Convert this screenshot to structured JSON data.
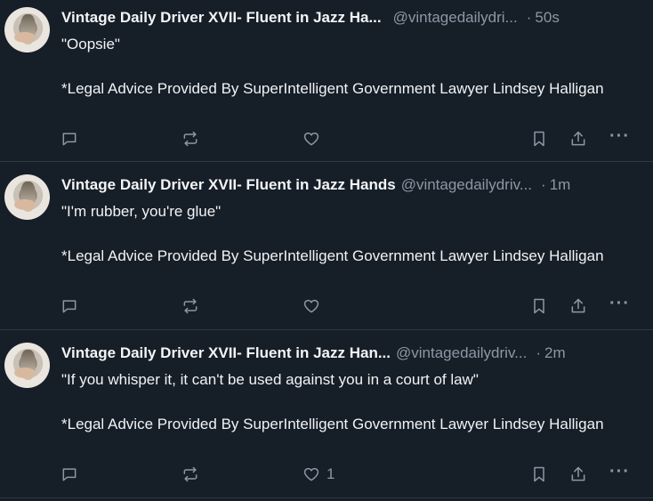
{
  "posts": [
    {
      "display_name": "Vintage Daily Driver XVII- Fluent in Jazz Ha...",
      "handle": "@vintagedailydri...",
      "dot": "·",
      "time": "50s",
      "quote": "\"Oopsie\"",
      "legal": "*Legal Advice Provided By SuperIntelligent Government Lawyer Lindsey Halligan",
      "like_count": ""
    },
    {
      "display_name": "Vintage Daily Driver XVII- Fluent in Jazz Hands",
      "handle": "@vintagedailydriv...",
      "dot": "·",
      "time": "1m",
      "quote": "\"I'm rubber, you're glue\"",
      "legal": "*Legal Advice Provided By SuperIntelligent Government Lawyer Lindsey Halligan",
      "like_count": ""
    },
    {
      "display_name": "Vintage Daily Driver XVII- Fluent in Jazz Han...",
      "handle": "@vintagedailydriv...",
      "dot": "·",
      "time": "2m",
      "quote": "\"If you whisper it, it can't be used against you in a court of law\"",
      "legal": "*Legal Advice Provided By SuperIntelligent Government Lawyer Lindsey Halligan",
      "like_count": "1"
    }
  ],
  "icons": {
    "reply": "reply-icon",
    "repost": "repost-icon",
    "like": "heart-icon",
    "bookmark": "bookmark-icon",
    "share": "share-icon",
    "more": "more-icon"
  },
  "colors": {
    "background": "#161e27",
    "text": "#f1f3f5",
    "muted": "#8b98a5",
    "divider": "#2e3a46"
  }
}
